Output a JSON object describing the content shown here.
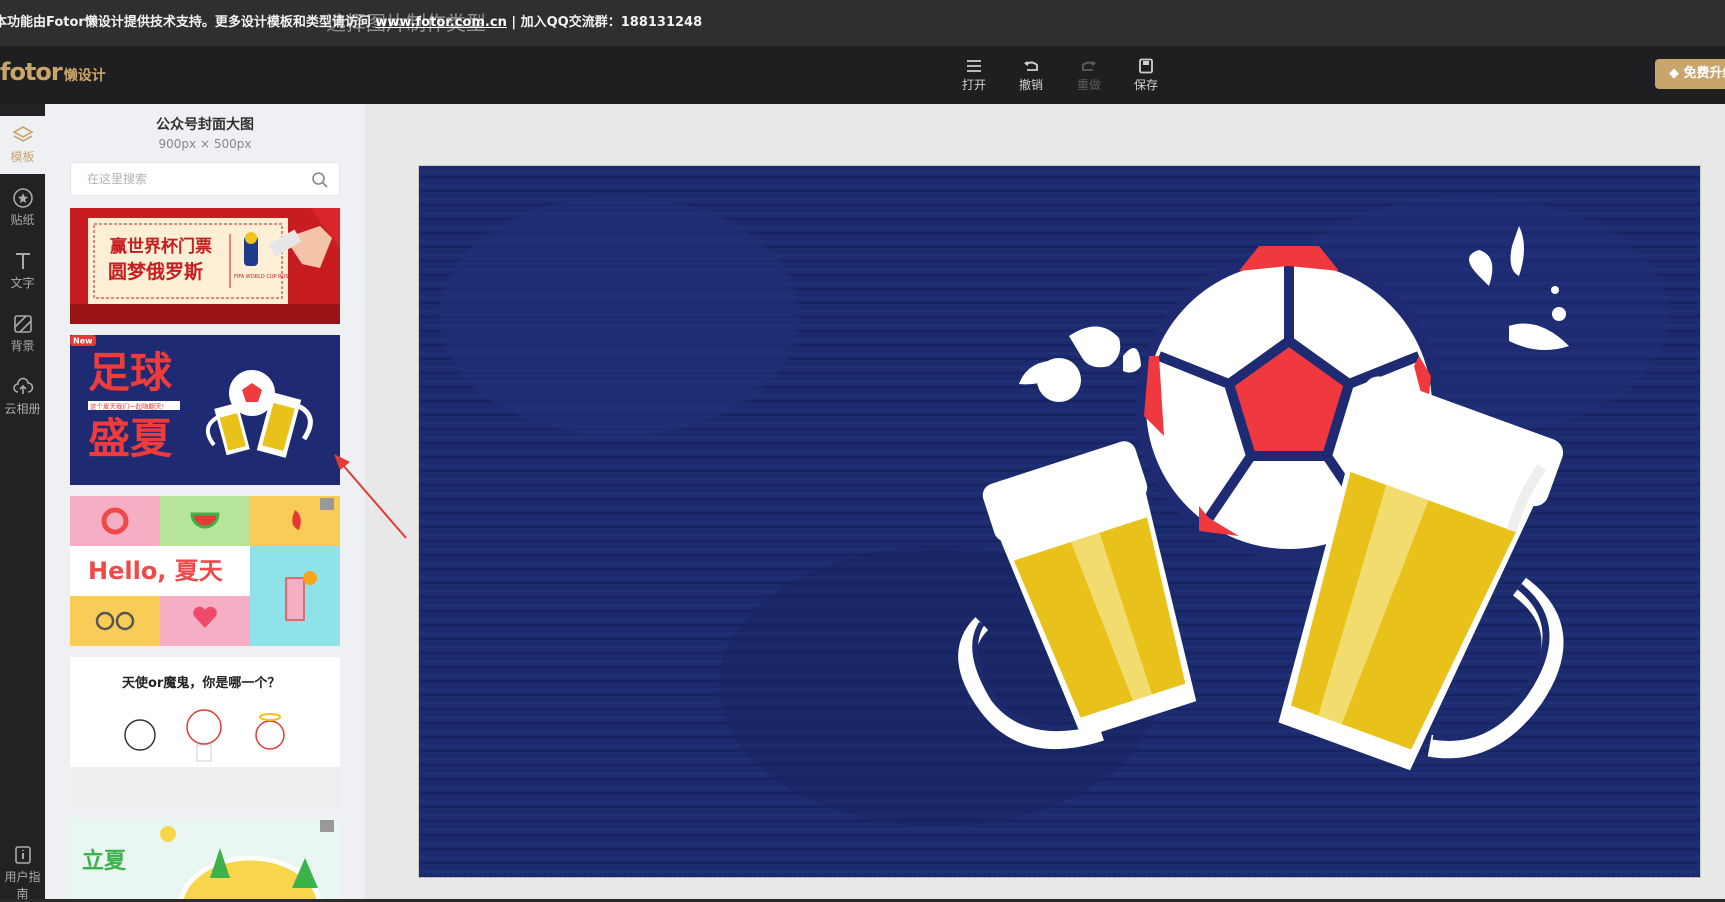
{
  "topbar": {
    "ghost_title": "选择图片制作类型",
    "notice_prefix": "本功能由Fotor懒设计提供技术支持。更多设计模板和类型请访问 ",
    "notice_link": "www.fotor.com.cn",
    "notice_suffix": " | 加入QQ交流群：188131248"
  },
  "header": {
    "logo_main": "fotor",
    "logo_sub": "懒设计",
    "tools": [
      {
        "label": "打开",
        "icon": "menu-icon",
        "enabled": true
      },
      {
        "label": "撤销",
        "icon": "undo-icon",
        "enabled": true
      },
      {
        "label": "重做",
        "icon": "redo-icon",
        "enabled": false
      },
      {
        "label": "保存",
        "icon": "save-icon",
        "enabled": true
      }
    ],
    "vip_label": "免费升级"
  },
  "nav": {
    "items": [
      {
        "label": "模板",
        "icon": "layers-icon",
        "active": true
      },
      {
        "label": "贴纸",
        "icon": "star-circle-icon",
        "active": false
      },
      {
        "label": "文字",
        "icon": "text-icon",
        "active": false
      },
      {
        "label": "背景",
        "icon": "background-icon",
        "active": false
      },
      {
        "label": "云相册",
        "icon": "cloud-upload-icon",
        "active": false
      },
      {
        "label": "用户指南",
        "icon": "info-icon",
        "active": false
      }
    ]
  },
  "panel": {
    "title": "公众号封面大图",
    "size": "900px × 500px",
    "search_placeholder": "在这里搜索"
  },
  "templates": [
    {
      "name": "world-cup-ticket",
      "line1": "赢世界杯门票",
      "line2": "圆梦俄罗斯",
      "badge": "FIFA WORLD CUP RUSSIA 2018"
    },
    {
      "name": "football-summer",
      "big1": "足球",
      "big2": "盛夏",
      "tag": "New",
      "small": "这个夏天我们一起嗨翻天!"
    },
    {
      "name": "hello-summer",
      "text": "Hello, 夏天"
    },
    {
      "name": "angel-or-devil",
      "text": "天使or魔鬼，你是哪一个？"
    },
    {
      "name": "lixia",
      "text": "立夏"
    }
  ],
  "colors": {
    "accent": "#c8a56b",
    "canvas_navy": "#1c2a6e",
    "ball_red": "#f0393f",
    "beer_yellow": "#e8c21a"
  }
}
